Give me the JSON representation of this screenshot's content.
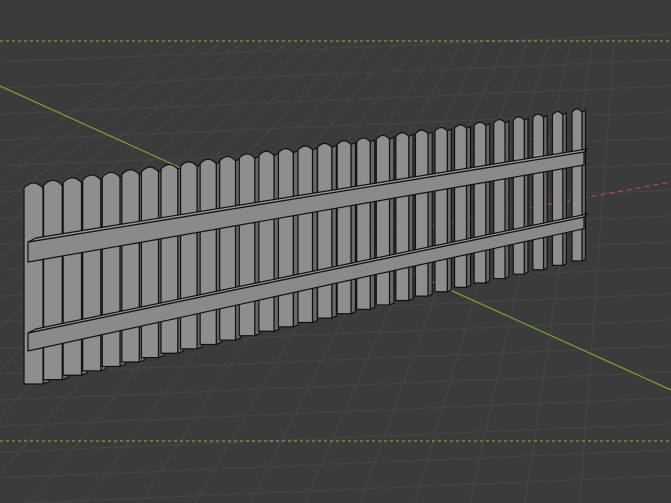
{
  "viewport": {
    "kind": "3d-viewport",
    "background_color": "#3b3b3b",
    "grid_color": "#474747",
    "x_axis_color": "#b24a4a",
    "y_axis_color": "#6f9f35",
    "camera_frame_color": "#c8b84a"
  },
  "scene": {
    "object": "picket-fence",
    "pickets_visible": 29,
    "rails_visible": 2,
    "fence_color": "#8e8e8e"
  }
}
